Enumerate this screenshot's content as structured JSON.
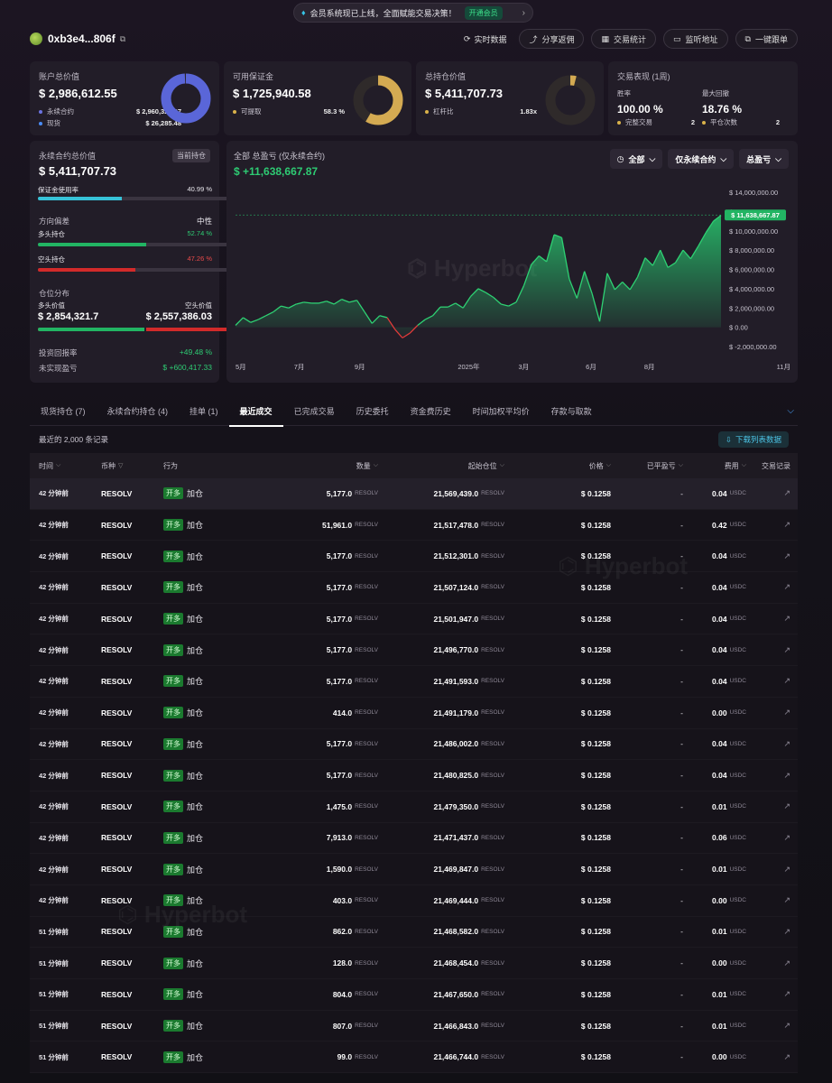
{
  "banner": {
    "text": "会员系统现已上线，全面赋能交易决策！",
    "cta": "开通会员"
  },
  "header": {
    "address": "0xb3e4...806f",
    "actions": [
      {
        "label": "实时数据",
        "icon": "refresh-icon"
      },
      {
        "label": "分享返佣",
        "icon": "share-icon"
      },
      {
        "label": "交易统计",
        "icon": "chart-icon"
      },
      {
        "label": "监听地址",
        "icon": "monitor-icon"
      },
      {
        "label": "一键跟单",
        "icon": "copy-trade-icon"
      }
    ]
  },
  "stats": {
    "account": {
      "title": "账户总价值",
      "value": "$ 2,986,612.55",
      "items": [
        {
          "label": "永续合约",
          "value": "$ 2,960,327.07",
          "color": "#6b73e0"
        },
        {
          "label": "现货",
          "value": "$ 26,285.48",
          "color": "#4a8cf7"
        }
      ],
      "donut_fraction": 0.991,
      "donut_color": "#5a66d8"
    },
    "margin": {
      "title": "可用保证金",
      "value": "$ 1,725,940.58",
      "items": [
        {
          "label": "可提取",
          "value": "58.3 %",
          "color": "#d9b24a"
        }
      ],
      "donut_fraction": 0.583,
      "donut_color": "#d4aa52"
    },
    "position": {
      "title": "总持仓价值",
      "value": "$ 5,411,707.73",
      "items": [
        {
          "label": "杠杆比",
          "value": "1.83x",
          "color": "#d9b24a"
        }
      ],
      "donut_fraction": 0.04,
      "donut_color": "#d4aa52"
    },
    "performance": {
      "title": "交易表现 (1周)",
      "win_rate_label": "胜率",
      "win_rate": "100.00 %",
      "drawdown_label": "最大回撤",
      "drawdown": "18.76 %",
      "completed_label": "完整交易",
      "completed": "2",
      "close_label": "平仓次数",
      "close": "2"
    }
  },
  "left_panel": {
    "title": "永续合约总价值",
    "badge": "当前持仓",
    "value": "$ 5,411,707.73",
    "margin_usage_label": "保证金使用率",
    "margin_usage": "40.99 %",
    "margin_usage_fraction": 0.41,
    "direction_label": "方向偏差",
    "direction_value": "中性",
    "long_label": "多头持仓",
    "long_pct": "52.74 %",
    "long_fraction": 0.5274,
    "short_label": "空头持仓",
    "short_pct": "47.26 %",
    "short_fraction": 0.4726,
    "distribution_label": "仓位分布",
    "long_value_label": "多头价值",
    "long_value": "$ 2,854,321.7",
    "short_value_label": "空头价值",
    "short_value": "$ 2,557,386.03",
    "distribution_fraction": 0.527,
    "roi_label": "投资回报率",
    "roi": "+49.48 %",
    "unrealized_label": "未实现盈亏",
    "unrealized": "$ +600,417.33"
  },
  "pnl_chart": {
    "title": "全部 总盈亏 (仅永续合约)",
    "value": "$ +11,638,667.87",
    "controls": [
      {
        "label": "全部",
        "icon": "clock-icon"
      },
      {
        "label": "仅永续合约"
      },
      {
        "label": "总盈亏"
      }
    ],
    "watermark": "Hyperbot"
  },
  "chart_data": {
    "type": "area",
    "title": "全部 总盈亏 (仅永续合约)",
    "x_ticks": [
      "5月",
      "7月",
      "9月",
      "2025年",
      "3月",
      "6月",
      "8月",
      "11月"
    ],
    "y_ticks": [
      "$ 14,000,000.00",
      "$ 12,000,000.00",
      "$ 10,000,000.00",
      "$ 8,000,000.00",
      "$ 6,000,000.00",
      "$ 4,000,000.00",
      "$ 2,000,000.00",
      "$ 0.00",
      "$ -2,000,000.00"
    ],
    "ylim": [
      -2000000,
      14000000
    ],
    "last_value_label": "$ 11,638,667.87",
    "last_value": 11638667.87,
    "series": [
      {
        "values": [
          200000,
          1000000,
          500000,
          800000,
          1200000,
          1600000,
          2200000,
          2000000,
          2400000,
          2600000,
          2500000,
          2500000,
          2700000,
          2400000,
          2900000,
          2600000,
          2800000,
          1600000,
          400000,
          1200000,
          1000000,
          -200000,
          -1100000,
          -600000,
          200000,
          800000,
          1200000,
          2100000,
          2100000,
          2500000,
          2000000,
          3200000,
          4000000,
          3600000,
          3100000,
          2400000,
          2200000,
          2600000,
          4300000,
          6500000,
          7400000,
          6800000,
          9600000,
          9300000,
          5000000,
          3000000,
          5800000,
          3500000,
          600000,
          5600000,
          3900000,
          4700000,
          3900000,
          5200000,
          7200000,
          6400000,
          8000000,
          6200000,
          6700000,
          8000000,
          7100000,
          8400000,
          9800000,
          11000000,
          11600000
        ]
      }
    ]
  },
  "tabs": [
    "现货持仓 (7)",
    "永续合约持仓 (4)",
    "挂单 (1)",
    "最近成交",
    "已完成交易",
    "历史委托",
    "资金费历史",
    "时间加权平均价",
    "存款与取款"
  ],
  "active_tab": 3,
  "records": {
    "label": "最近的 2,000 条记录",
    "download": "下载列表数据"
  },
  "table": {
    "headers": [
      "时间",
      "币种",
      "行为",
      "数量",
      "起始仓位",
      "价格",
      "已平盈亏",
      "费用",
      "交易记录"
    ],
    "rows": [
      {
        "time": "42 分钟前",
        "coin": "RESOLV",
        "tag": "开多",
        "act": "加仓",
        "qty": "5,177.0",
        "qty_unit": "RESOLV",
        "start": "21,569,439.0",
        "start_unit": "RESOLV",
        "price": "$ 0.1258",
        "pnl": "-",
        "fee": "0.04",
        "fee_unit": "USDC"
      },
      {
        "time": "42 分钟前",
        "coin": "RESOLV",
        "tag": "开多",
        "act": "加仓",
        "qty": "51,961.0",
        "qty_unit": "RESOLV",
        "start": "21,517,478.0",
        "start_unit": "RESOLV",
        "price": "$ 0.1258",
        "pnl": "-",
        "fee": "0.42",
        "fee_unit": "USDC"
      },
      {
        "time": "42 分钟前",
        "coin": "RESOLV",
        "tag": "开多",
        "act": "加仓",
        "qty": "5,177.0",
        "qty_unit": "RESOLV",
        "start": "21,512,301.0",
        "start_unit": "RESOLV",
        "price": "$ 0.1258",
        "pnl": "-",
        "fee": "0.04",
        "fee_unit": "USDC"
      },
      {
        "time": "42 分钟前",
        "coin": "RESOLV",
        "tag": "开多",
        "act": "加仓",
        "qty": "5,177.0",
        "qty_unit": "RESOLV",
        "start": "21,507,124.0",
        "start_unit": "RESOLV",
        "price": "$ 0.1258",
        "pnl": "-",
        "fee": "0.04",
        "fee_unit": "USDC"
      },
      {
        "time": "42 分钟前",
        "coin": "RESOLV",
        "tag": "开多",
        "act": "加仓",
        "qty": "5,177.0",
        "qty_unit": "RESOLV",
        "start": "21,501,947.0",
        "start_unit": "RESOLV",
        "price": "$ 0.1258",
        "pnl": "-",
        "fee": "0.04",
        "fee_unit": "USDC"
      },
      {
        "time": "42 分钟前",
        "coin": "RESOLV",
        "tag": "开多",
        "act": "加仓",
        "qty": "5,177.0",
        "qty_unit": "RESOLV",
        "start": "21,496,770.0",
        "start_unit": "RESOLV",
        "price": "$ 0.1258",
        "pnl": "-",
        "fee": "0.04",
        "fee_unit": "USDC"
      },
      {
        "time": "42 分钟前",
        "coin": "RESOLV",
        "tag": "开多",
        "act": "加仓",
        "qty": "5,177.0",
        "qty_unit": "RESOLV",
        "start": "21,491,593.0",
        "start_unit": "RESOLV",
        "price": "$ 0.1258",
        "pnl": "-",
        "fee": "0.04",
        "fee_unit": "USDC"
      },
      {
        "time": "42 分钟前",
        "coin": "RESOLV",
        "tag": "开多",
        "act": "加仓",
        "qty": "414.0",
        "qty_unit": "RESOLV",
        "start": "21,491,179.0",
        "start_unit": "RESOLV",
        "price": "$ 0.1258",
        "pnl": "-",
        "fee": "0.00",
        "fee_unit": "USDC"
      },
      {
        "time": "42 分钟前",
        "coin": "RESOLV",
        "tag": "开多",
        "act": "加仓",
        "qty": "5,177.0",
        "qty_unit": "RESOLV",
        "start": "21,486,002.0",
        "start_unit": "RESOLV",
        "price": "$ 0.1258",
        "pnl": "-",
        "fee": "0.04",
        "fee_unit": "USDC"
      },
      {
        "time": "42 分钟前",
        "coin": "RESOLV",
        "tag": "开多",
        "act": "加仓",
        "qty": "5,177.0",
        "qty_unit": "RESOLV",
        "start": "21,480,825.0",
        "start_unit": "RESOLV",
        "price": "$ 0.1258",
        "pnl": "-",
        "fee": "0.04",
        "fee_unit": "USDC"
      },
      {
        "time": "42 分钟前",
        "coin": "RESOLV",
        "tag": "开多",
        "act": "加仓",
        "qty": "1,475.0",
        "qty_unit": "RESOLV",
        "start": "21,479,350.0",
        "start_unit": "RESOLV",
        "price": "$ 0.1258",
        "pnl": "-",
        "fee": "0.01",
        "fee_unit": "USDC"
      },
      {
        "time": "42 分钟前",
        "coin": "RESOLV",
        "tag": "开多",
        "act": "加仓",
        "qty": "7,913.0",
        "qty_unit": "RESOLV",
        "start": "21,471,437.0",
        "start_unit": "RESOLV",
        "price": "$ 0.1258",
        "pnl": "-",
        "fee": "0.06",
        "fee_unit": "USDC"
      },
      {
        "time": "42 分钟前",
        "coin": "RESOLV",
        "tag": "开多",
        "act": "加仓",
        "qty": "1,590.0",
        "qty_unit": "RESOLV",
        "start": "21,469,847.0",
        "start_unit": "RESOLV",
        "price": "$ 0.1258",
        "pnl": "-",
        "fee": "0.01",
        "fee_unit": "USDC"
      },
      {
        "time": "42 分钟前",
        "coin": "RESOLV",
        "tag": "开多",
        "act": "加仓",
        "qty": "403.0",
        "qty_unit": "RESOLV",
        "start": "21,469,444.0",
        "start_unit": "RESOLV",
        "price": "$ 0.1258",
        "pnl": "-",
        "fee": "0.00",
        "fee_unit": "USDC"
      },
      {
        "time": "51 分钟前",
        "coin": "RESOLV",
        "tag": "开多",
        "act": "加仓",
        "qty": "862.0",
        "qty_unit": "RESOLV",
        "start": "21,468,582.0",
        "start_unit": "RESOLV",
        "price": "$ 0.1258",
        "pnl": "-",
        "fee": "0.01",
        "fee_unit": "USDC"
      },
      {
        "time": "51 分钟前",
        "coin": "RESOLV",
        "tag": "开多",
        "act": "加仓",
        "qty": "128.0",
        "qty_unit": "RESOLV",
        "start": "21,468,454.0",
        "start_unit": "RESOLV",
        "price": "$ 0.1258",
        "pnl": "-",
        "fee": "0.00",
        "fee_unit": "USDC"
      },
      {
        "time": "51 分钟前",
        "coin": "RESOLV",
        "tag": "开多",
        "act": "加仓",
        "qty": "804.0",
        "qty_unit": "RESOLV",
        "start": "21,467,650.0",
        "start_unit": "RESOLV",
        "price": "$ 0.1258",
        "pnl": "-",
        "fee": "0.01",
        "fee_unit": "USDC"
      },
      {
        "time": "51 分钟前",
        "coin": "RESOLV",
        "tag": "开多",
        "act": "加仓",
        "qty": "807.0",
        "qty_unit": "RESOLV",
        "start": "21,466,843.0",
        "start_unit": "RESOLV",
        "price": "$ 0.1258",
        "pnl": "-",
        "fee": "0.01",
        "fee_unit": "USDC"
      },
      {
        "time": "51 分钟前",
        "coin": "RESOLV",
        "tag": "开多",
        "act": "加仓",
        "qty": "99.0",
        "qty_unit": "RESOLV",
        "start": "21,466,744.0",
        "start_unit": "RESOLV",
        "price": "$ 0.1258",
        "pnl": "-",
        "fee": "0.00",
        "fee_unit": "USDC"
      }
    ]
  }
}
